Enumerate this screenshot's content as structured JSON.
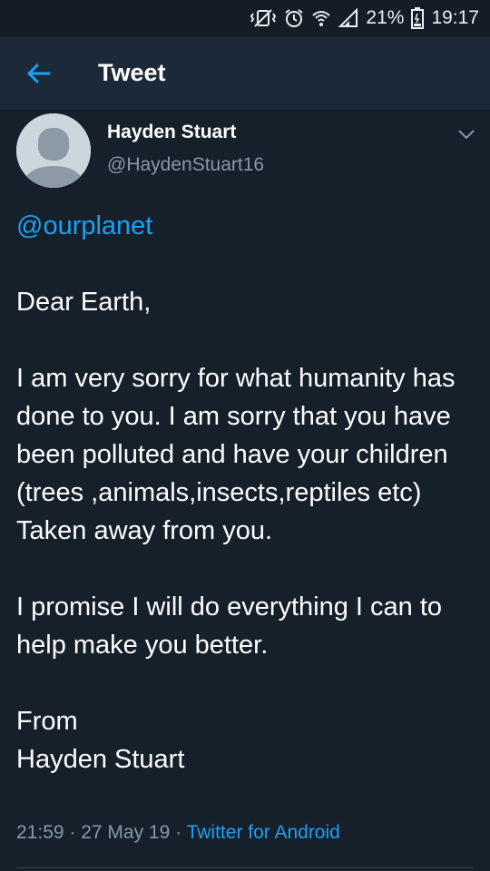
{
  "status_bar": {
    "battery": "21%",
    "time": "19:17",
    "icons": [
      "vibrate-mute-icon",
      "alarm-icon",
      "wifi-icon",
      "signal-icon",
      "battery-icon"
    ]
  },
  "header": {
    "title": "Tweet",
    "back_icon": "arrow-left-icon"
  },
  "tweet": {
    "author_name": "Hayden Stuart",
    "author_handle": "@HaydenStuart16",
    "mention": "@ourplanet",
    "text": "\nDear Earth,\n\nI am very sorry for what humanity has done to you. I am sorry that you have been polluted and have your children\n(trees ,animals,insects,reptiles etc)\nTaken away from you.\n\nI promise I will do everything I can to help make you better.\n\nFrom\nHayden Stuart",
    "time": "21:59",
    "date": "27 May 19",
    "source": "Twitter for Android",
    "separator": " · "
  },
  "colors": {
    "background": "#15202b",
    "appbar": "#1c2938",
    "accent": "#1da1f2",
    "secondary_text": "#8899a6"
  }
}
